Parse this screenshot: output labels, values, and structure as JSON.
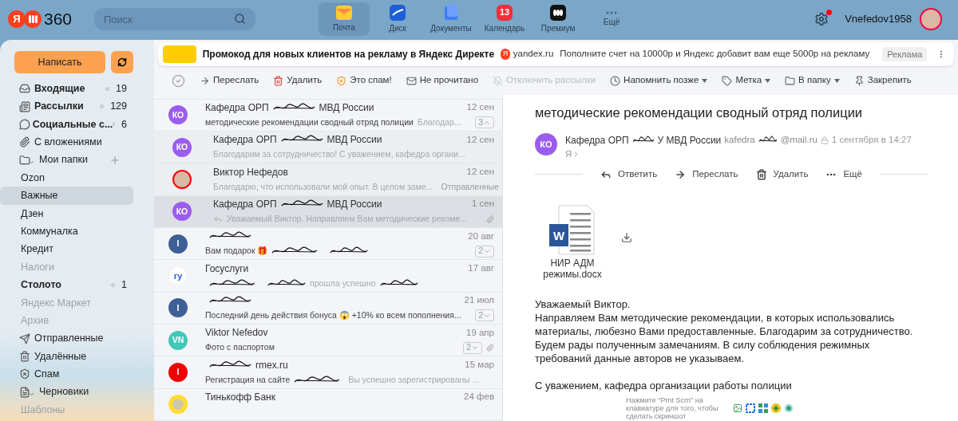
{
  "header": {
    "logo": {
      "letter": "Я",
      "number": "360"
    },
    "search": {
      "placeholder": "Поиск"
    },
    "apps": [
      {
        "label": "Почта",
        "selected": true
      },
      {
        "label": "Диск",
        "selected": false
      },
      {
        "label": "Документы",
        "selected": false
      },
      {
        "label": "Календарь",
        "selected": false,
        "badge": "13"
      },
      {
        "label": "Премиум",
        "selected": false
      },
      {
        "label": "Ещё",
        "selected": false
      }
    ],
    "settings_notification": true,
    "username": "Vnefedov1958"
  },
  "sidebar": {
    "compose": "Написать",
    "folders": [
      {
        "label": "Входящие",
        "count": "19",
        "unread": true,
        "dimmed": false,
        "selected": false
      },
      {
        "label": "Рассылки",
        "count": "129",
        "unread": true,
        "dimmed": false,
        "selected": false
      },
      {
        "label": "Социальные с...",
        "count": "6",
        "unread": true,
        "dimmed": false,
        "selected": false
      },
      {
        "label": "С вложениями",
        "unread": false,
        "dimmed": false,
        "selected": false
      },
      {
        "label": "Мои папки",
        "unread": false,
        "dimmed": false,
        "selected": false,
        "expanded": true,
        "children": [
          {
            "label": "Ozon",
            "unread": false,
            "dimmed": false,
            "selected": false
          },
          {
            "label": "Важные",
            "unread": false,
            "dimmed": false,
            "selected": true
          },
          {
            "label": "Дзен",
            "unread": false,
            "dimmed": false,
            "selected": false
          },
          {
            "label": "Коммуналка",
            "unread": false,
            "dimmed": false,
            "selected": false
          },
          {
            "label": "Кредит",
            "unread": false,
            "dimmed": false,
            "selected": false
          },
          {
            "label": "Налоги",
            "unread": false,
            "dimmed": true,
            "selected": false
          },
          {
            "label": "Столото",
            "count": "1",
            "unread": true,
            "dimmed": false,
            "selected": false
          },
          {
            "label": "Яндекс Маркет",
            "unread": false,
            "dimmed": true,
            "selected": false
          },
          {
            "label": "Архив",
            "unread": false,
            "dimmed": true,
            "selected": false
          }
        ]
      },
      {
        "label": "Отправленные",
        "unread": false,
        "dimmed": false,
        "selected": false
      },
      {
        "label": "Удалённые",
        "unread": false,
        "dimmed": false,
        "selected": false
      },
      {
        "label": "Спам",
        "unread": false,
        "dimmed": false,
        "selected": false
      },
      {
        "label": "Черновики",
        "unread": false,
        "dimmed": false,
        "selected": false,
        "expanded": true,
        "children": [
          {
            "label": "Шаблоны",
            "unread": false,
            "dimmed": true,
            "selected": false
          }
        ]
      }
    ]
  },
  "ad": {
    "logo": "Я",
    "title": "Промокод для новых клиентов на рекламу в Яндекс Директе",
    "domain": "yandex.ru",
    "text": "Пополните счет на 10000р и Яндекс добавит вам еще 5000р на рекламу",
    "badge": "Реклама"
  },
  "select_all": {
    "checked": false
  },
  "toolbar": [
    {
      "label": "Переслать",
      "disabled": false,
      "dropdown": false
    },
    {
      "label": "Удалить",
      "disabled": false,
      "dropdown": false
    },
    {
      "label": "Это спам!",
      "disabled": false,
      "dropdown": false
    },
    {
      "label": "Не прочитано",
      "disabled": false,
      "dropdown": false
    },
    {
      "label": "Отключить рассылки",
      "disabled": true,
      "dropdown": false
    },
    {
      "label": "Напомнить позже",
      "disabled": false,
      "dropdown": true
    },
    {
      "label": "Метка",
      "disabled": false,
      "dropdown": true
    },
    {
      "label": "В папку",
      "disabled": false,
      "dropdown": true
    },
    {
      "label": "Закрепить",
      "disabled": false,
      "dropdown": false
    }
  ],
  "messages": [
    {
      "avatar": {
        "kind": "initials",
        "text": "КО",
        "color": "#9b5cf0"
      },
      "indent": false,
      "selected": false,
      "sender": [
        {
          "kind": "text",
          "text": "Кафедра ОРП"
        },
        {
          "kind": "scribble"
        },
        {
          "kind": "text",
          "text": "МВД России"
        }
      ],
      "date": "12 сен",
      "subject": [
        {
          "kind": "text",
          "text": "методические рекомендации сводный отряд полиции"
        }
      ],
      "snippet": [
        {
          "kind": "text",
          "text": "Благодар..."
        }
      ],
      "thread": {
        "count": "3",
        "expanded": true
      }
    },
    {
      "avatar": {
        "kind": "initials",
        "text": "КО",
        "color": "#9b5cf0"
      },
      "indent": true,
      "selected": false,
      "sender": [
        {
          "kind": "text",
          "text": "Кафедра ОРП"
        },
        {
          "kind": "scribble"
        },
        {
          "kind": "text",
          "text": "МВД России"
        }
      ],
      "date": "12 сен",
      "snippet": [
        {
          "kind": "text",
          "text": "Благодарим за сотрудничество! С уважением, кафедра органи..."
        }
      ]
    },
    {
      "avatar": {
        "kind": "photo"
      },
      "indent": true,
      "selected": false,
      "sender": [
        {
          "kind": "text",
          "text": "Виктор Нефедов"
        }
      ],
      "date": "12 сен",
      "snippet": [
        {
          "kind": "text",
          "text": "Благодарю, что использовали мой опыт. В целом заме..."
        }
      ],
      "folder": "Отправленные"
    },
    {
      "avatar": {
        "kind": "initials",
        "text": "КО",
        "color": "#9b5cf0"
      },
      "indent": true,
      "selected": true,
      "replied": true,
      "attachment": true,
      "sender": [
        {
          "kind": "text",
          "text": "Кафедра ОРП"
        },
        {
          "kind": "scribble"
        },
        {
          "kind": "text",
          "text": "МВД России"
        }
      ],
      "date": "1 сен",
      "snippet": [
        {
          "kind": "text",
          "text": "Уважаемый Виктор. Направляем Вам методические рекоме..."
        }
      ]
    },
    {
      "avatar": {
        "kind": "initials",
        "text": "I",
        "color": "#3d5f95"
      },
      "indent": false,
      "selected": false,
      "sender": [
        {
          "kind": "scribble"
        }
      ],
      "date": "20 авг",
      "subject": [
        {
          "kind": "text",
          "text": "Вам подарок 🎁"
        },
        {
          "kind": "scribble"
        }
      ],
      "snippet": [
        {
          "kind": "scribble"
        }
      ],
      "thread": {
        "count": "2",
        "expanded": false
      }
    },
    {
      "avatar": {
        "kind": "gu",
        "text": "гу",
        "color": "#ffffff"
      },
      "indent": false,
      "selected": false,
      "sender": [
        {
          "kind": "text",
          "text": "Госуслуги"
        }
      ],
      "date": "17 авг",
      "subject": [
        {
          "kind": "scribble"
        }
      ],
      "snippet": [
        {
          "kind": "scribble"
        },
        {
          "kind": "text",
          "text": "прошла успешно"
        },
        {
          "kind": "scribble"
        }
      ]
    },
    {
      "avatar": {
        "kind": "initials",
        "text": "I",
        "color": "#3d5f95"
      },
      "indent": false,
      "selected": false,
      "sender": [
        {
          "kind": "scribble"
        }
      ],
      "date": "21 июл",
      "subject": [
        {
          "kind": "text",
          "text": "Последний день действия бонуса 😱 +10% ко всем пополнения..."
        }
      ],
      "thread": {
        "count": "2",
        "expanded": false
      }
    },
    {
      "avatar": {
        "kind": "initials",
        "text": "VN",
        "color": "#40c8b8"
      },
      "indent": false,
      "selected": false,
      "attachment": true,
      "sender": [
        {
          "kind": "text",
          "text": "Viktor Nefedov"
        }
      ],
      "date": "19 апр",
      "subject": [
        {
          "kind": "text",
          "text": "Фото с паспортом"
        }
      ],
      "thread": {
        "count": "2",
        "expanded": false
      }
    },
    {
      "avatar": {
        "kind": "initials",
        "text": "I",
        "color": "#f00000"
      },
      "indent": false,
      "selected": false,
      "sender": [
        {
          "kind": "scribble"
        },
        {
          "kind": "text",
          "text": "rmex.ru"
        }
      ],
      "date": "15 мар",
      "subject": [
        {
          "kind": "text",
          "text": "Регистрация на сайте"
        },
        {
          "kind": "scribble"
        }
      ],
      "snippet": [
        {
          "kind": "text",
          "text": "Вы успешно зарегистрированы ..."
        }
      ]
    },
    {
      "avatar": {
        "kind": "emblem",
        "color": "#ffdd2d"
      },
      "indent": false,
      "selected": false,
      "sender": [
        {
          "kind": "text",
          "text": "Тинькофф Банк"
        }
      ],
      "date": "24 фев"
    }
  ],
  "reader": {
    "subject": "методические рекомендации сводный отряд полиции",
    "avatar": {
      "text": "КО",
      "color": "#9b5cf0"
    },
    "sender": [
      {
        "kind": "text",
        "text": "Кафедра ОРП"
      },
      {
        "kind": "scribble"
      },
      {
        "kind": "text",
        "text": "У МВД России"
      }
    ],
    "email": [
      {
        "kind": "text",
        "text": "kafedra"
      },
      {
        "kind": "scribble"
      },
      {
        "kind": "text",
        "text": "@mail.ru"
      }
    ],
    "date": "1 сентября в 14:27",
    "to": "Я",
    "actions": [
      "Ответить",
      "Переслать",
      "Удалить",
      "Ещё"
    ],
    "attachment": {
      "name_lines": [
        "НИР АДМ",
        "режимы.docx"
      ],
      "badge": "W"
    },
    "body": [
      "Уважаемый Виктор.",
      "Направляем Вам методические рекомендации, в которых использовались материалы, любезно Вами предоставленные. Благодарим за сотрудничество. Будем рады полученным замечаниям. В силу соблюдения режимных требований данные авторов не указываем."
    ],
    "signature": "С уважением, кафедра организации работы полиции"
  },
  "screenshot_hint": {
    "text": "Нажмите \"Prnt Scrn\" на клавиатуре для того, чтобы сделать скриншот"
  }
}
